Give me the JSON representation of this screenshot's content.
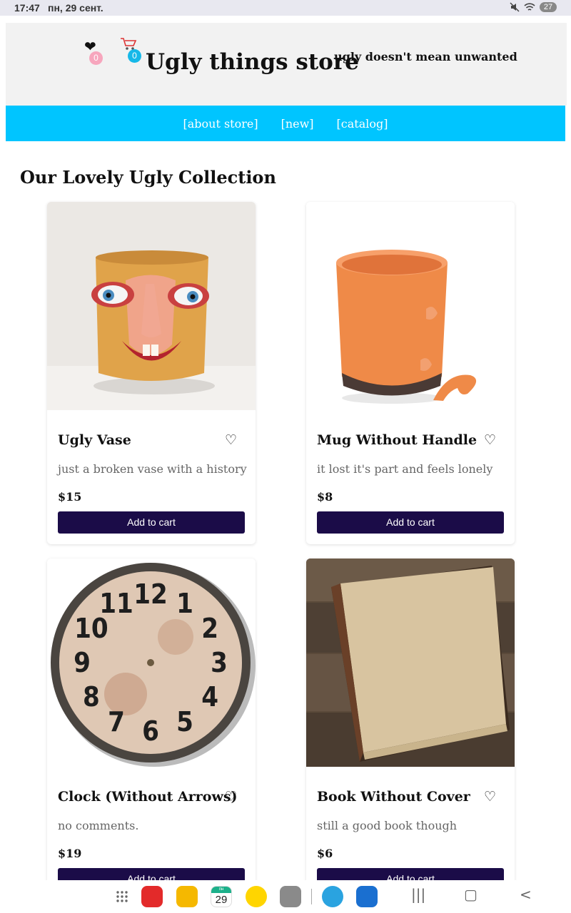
{
  "status": {
    "time": "17:47",
    "date": "пн, 29 сент.",
    "battery": "27"
  },
  "header": {
    "title": "Ugly things store",
    "tagline": "ugly doesn't mean unwanted",
    "fav_count": "0",
    "cart_count": "0"
  },
  "nav": {
    "items": [
      "[about store]",
      "[new]",
      "[catalog]"
    ]
  },
  "collection": {
    "title": "Our Lovely Ugly Collection",
    "products": [
      {
        "name": "Ugly Vase",
        "description": "just a broken vase with a history",
        "price": "$15",
        "button": "Add to cart",
        "fav_icon": "♡"
      },
      {
        "name": "Mug Without Handle",
        "description": "it lost it's part and feels lonely",
        "price": "$8",
        "button": "Add to cart",
        "fav_icon": "♡"
      },
      {
        "name": "Clock (Without Arrows)",
        "description": "no comments.",
        "price": "$19",
        "button": "Add to cart",
        "fav_icon": "♡"
      },
      {
        "name": "Book Without Cover",
        "description": "still a good book though",
        "price": "$6",
        "button": "Add to cart",
        "fav_icon": "♡"
      }
    ]
  },
  "clock_numbers": [
    "12",
    "1",
    "2",
    "3",
    "4",
    "5",
    "6",
    "7",
    "8",
    "9",
    "10",
    "11"
  ],
  "taskbar": {
    "calendar_day": "29",
    "calendar_label": "пн"
  },
  "colors": {
    "nav": "#00c5ff",
    "button": "#1b0c48",
    "fav_badge": "#f7a6bd",
    "cart_badge": "#16b8e8"
  }
}
